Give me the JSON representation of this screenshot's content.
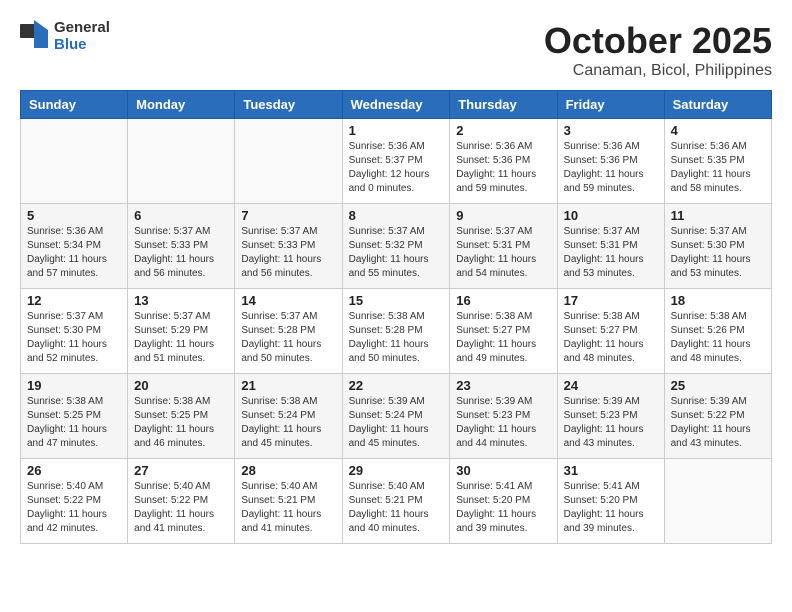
{
  "header": {
    "logo": {
      "general": "General",
      "blue": "Blue"
    },
    "month": "October 2025",
    "location": "Canaman, Bicol, Philippines"
  },
  "weekdays": [
    "Sunday",
    "Monday",
    "Tuesday",
    "Wednesday",
    "Thursday",
    "Friday",
    "Saturday"
  ],
  "weeks": [
    [
      {
        "day": "",
        "info": ""
      },
      {
        "day": "",
        "info": ""
      },
      {
        "day": "",
        "info": ""
      },
      {
        "day": "1",
        "info": "Sunrise: 5:36 AM\nSunset: 5:37 PM\nDaylight: 12 hours\nand 0 minutes."
      },
      {
        "day": "2",
        "info": "Sunrise: 5:36 AM\nSunset: 5:36 PM\nDaylight: 11 hours\nand 59 minutes."
      },
      {
        "day": "3",
        "info": "Sunrise: 5:36 AM\nSunset: 5:36 PM\nDaylight: 11 hours\nand 59 minutes."
      },
      {
        "day": "4",
        "info": "Sunrise: 5:36 AM\nSunset: 5:35 PM\nDaylight: 11 hours\nand 58 minutes."
      }
    ],
    [
      {
        "day": "5",
        "info": "Sunrise: 5:36 AM\nSunset: 5:34 PM\nDaylight: 11 hours\nand 57 minutes."
      },
      {
        "day": "6",
        "info": "Sunrise: 5:37 AM\nSunset: 5:33 PM\nDaylight: 11 hours\nand 56 minutes."
      },
      {
        "day": "7",
        "info": "Sunrise: 5:37 AM\nSunset: 5:33 PM\nDaylight: 11 hours\nand 56 minutes."
      },
      {
        "day": "8",
        "info": "Sunrise: 5:37 AM\nSunset: 5:32 PM\nDaylight: 11 hours\nand 55 minutes."
      },
      {
        "day": "9",
        "info": "Sunrise: 5:37 AM\nSunset: 5:31 PM\nDaylight: 11 hours\nand 54 minutes."
      },
      {
        "day": "10",
        "info": "Sunrise: 5:37 AM\nSunset: 5:31 PM\nDaylight: 11 hours\nand 53 minutes."
      },
      {
        "day": "11",
        "info": "Sunrise: 5:37 AM\nSunset: 5:30 PM\nDaylight: 11 hours\nand 53 minutes."
      }
    ],
    [
      {
        "day": "12",
        "info": "Sunrise: 5:37 AM\nSunset: 5:30 PM\nDaylight: 11 hours\nand 52 minutes."
      },
      {
        "day": "13",
        "info": "Sunrise: 5:37 AM\nSunset: 5:29 PM\nDaylight: 11 hours\nand 51 minutes."
      },
      {
        "day": "14",
        "info": "Sunrise: 5:37 AM\nSunset: 5:28 PM\nDaylight: 11 hours\nand 50 minutes."
      },
      {
        "day": "15",
        "info": "Sunrise: 5:38 AM\nSunset: 5:28 PM\nDaylight: 11 hours\nand 50 minutes."
      },
      {
        "day": "16",
        "info": "Sunrise: 5:38 AM\nSunset: 5:27 PM\nDaylight: 11 hours\nand 49 minutes."
      },
      {
        "day": "17",
        "info": "Sunrise: 5:38 AM\nSunset: 5:27 PM\nDaylight: 11 hours\nand 48 minutes."
      },
      {
        "day": "18",
        "info": "Sunrise: 5:38 AM\nSunset: 5:26 PM\nDaylight: 11 hours\nand 48 minutes."
      }
    ],
    [
      {
        "day": "19",
        "info": "Sunrise: 5:38 AM\nSunset: 5:25 PM\nDaylight: 11 hours\nand 47 minutes."
      },
      {
        "day": "20",
        "info": "Sunrise: 5:38 AM\nSunset: 5:25 PM\nDaylight: 11 hours\nand 46 minutes."
      },
      {
        "day": "21",
        "info": "Sunrise: 5:38 AM\nSunset: 5:24 PM\nDaylight: 11 hours\nand 45 minutes."
      },
      {
        "day": "22",
        "info": "Sunrise: 5:39 AM\nSunset: 5:24 PM\nDaylight: 11 hours\nand 45 minutes."
      },
      {
        "day": "23",
        "info": "Sunrise: 5:39 AM\nSunset: 5:23 PM\nDaylight: 11 hours\nand 44 minutes."
      },
      {
        "day": "24",
        "info": "Sunrise: 5:39 AM\nSunset: 5:23 PM\nDaylight: 11 hours\nand 43 minutes."
      },
      {
        "day": "25",
        "info": "Sunrise: 5:39 AM\nSunset: 5:22 PM\nDaylight: 11 hours\nand 43 minutes."
      }
    ],
    [
      {
        "day": "26",
        "info": "Sunrise: 5:40 AM\nSunset: 5:22 PM\nDaylight: 11 hours\nand 42 minutes."
      },
      {
        "day": "27",
        "info": "Sunrise: 5:40 AM\nSunset: 5:22 PM\nDaylight: 11 hours\nand 41 minutes."
      },
      {
        "day": "28",
        "info": "Sunrise: 5:40 AM\nSunset: 5:21 PM\nDaylight: 11 hours\nand 41 minutes."
      },
      {
        "day": "29",
        "info": "Sunrise: 5:40 AM\nSunset: 5:21 PM\nDaylight: 11 hours\nand 40 minutes."
      },
      {
        "day": "30",
        "info": "Sunrise: 5:41 AM\nSunset: 5:20 PM\nDaylight: 11 hours\nand 39 minutes."
      },
      {
        "day": "31",
        "info": "Sunrise: 5:41 AM\nSunset: 5:20 PM\nDaylight: 11 hours\nand 39 minutes."
      },
      {
        "day": "",
        "info": ""
      }
    ]
  ]
}
